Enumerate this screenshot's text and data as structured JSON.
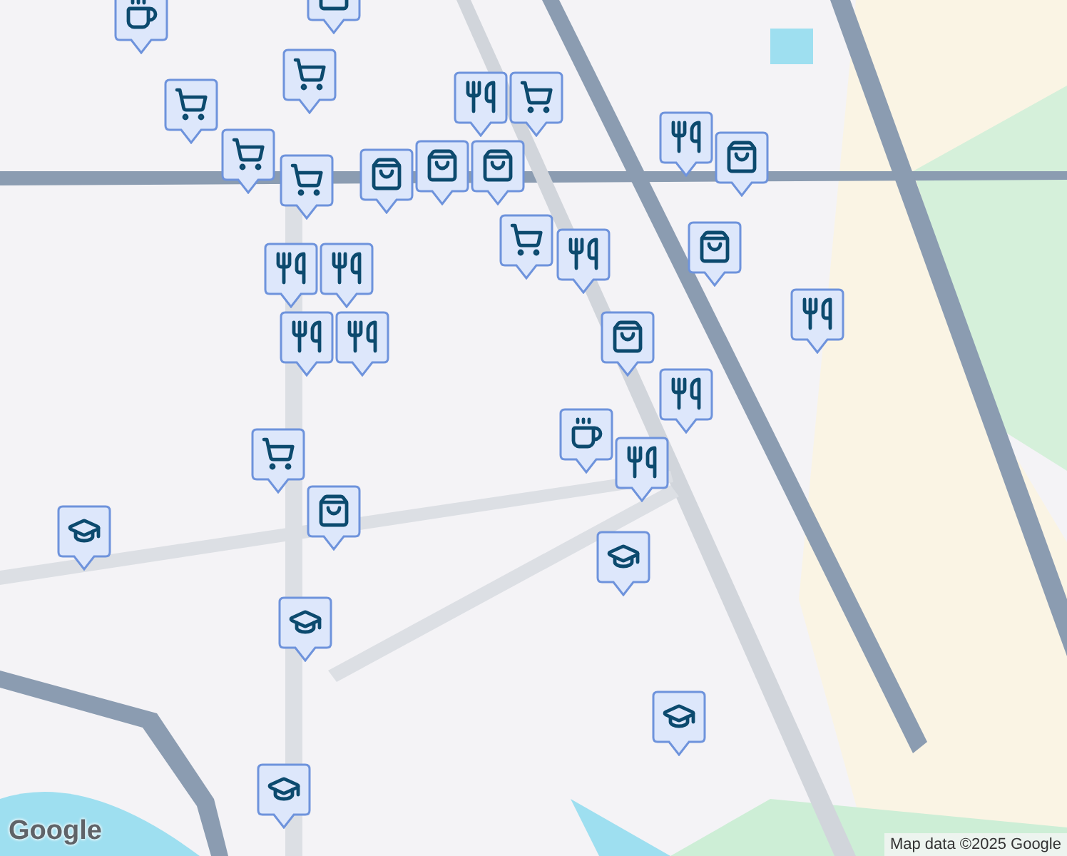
{
  "markers": [
    {
      "kind": "cup"
    },
    {
      "kind": "bag"
    },
    {
      "kind": "cart"
    },
    {
      "kind": "cart"
    },
    {
      "kind": "cart"
    },
    {
      "kind": "cart"
    },
    {
      "kind": "bag"
    },
    {
      "kind": "bag"
    },
    {
      "kind": "restaurant"
    },
    {
      "kind": "cart"
    },
    {
      "kind": "bag"
    },
    {
      "kind": "cart"
    },
    {
      "kind": "restaurant"
    },
    {
      "kind": "restaurant"
    },
    {
      "kind": "restaurant"
    },
    {
      "kind": "restaurant"
    },
    {
      "kind": "restaurant"
    },
    {
      "kind": "restaurant"
    },
    {
      "kind": "bag"
    },
    {
      "kind": "bag"
    },
    {
      "kind": "restaurant"
    },
    {
      "kind": "bag"
    },
    {
      "kind": "restaurant"
    },
    {
      "kind": "cup"
    },
    {
      "kind": "restaurant"
    },
    {
      "kind": "cart"
    },
    {
      "kind": "bag"
    },
    {
      "kind": "school"
    },
    {
      "kind": "school"
    },
    {
      "kind": "school"
    },
    {
      "kind": "school"
    },
    {
      "kind": "school"
    }
  ],
  "logo": "Google",
  "attribution": "Map data ©2025 Google"
}
